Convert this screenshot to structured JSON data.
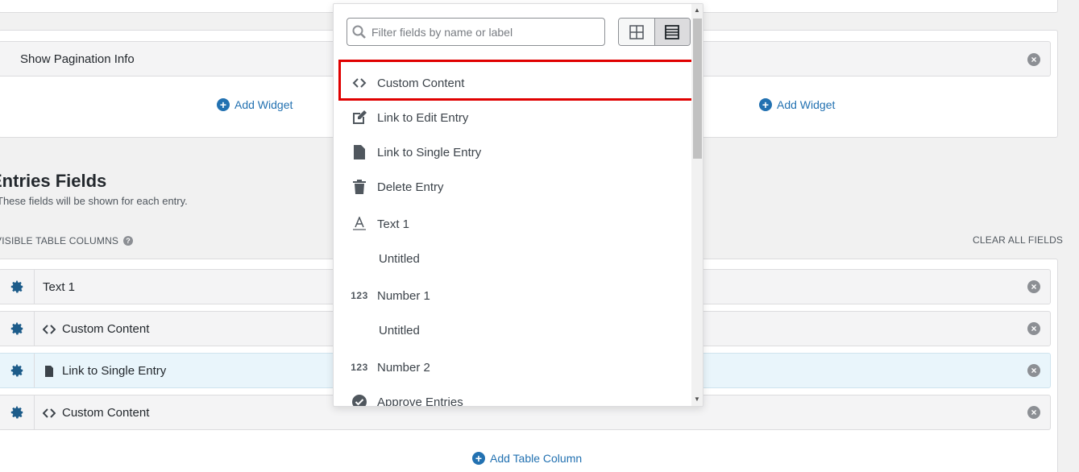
{
  "header": {
    "widget_row_label": "Show Pagination Info",
    "add_widget_left": "Add Widget",
    "add_widget_right": "Add Widget"
  },
  "section": {
    "title": "Entries Fields",
    "description": "These fields will be shown for each entry.",
    "columns_label": "VISIBLE TABLE COLUMNS",
    "clear_all": "CLEAR ALL FIELDS",
    "add_column": "Add Table Column"
  },
  "fields": [
    {
      "label": "Text 1",
      "icon": "none"
    },
    {
      "label": "Custom Content",
      "icon": "code-icon"
    },
    {
      "label": "Link to Single Entry",
      "icon": "document-icon"
    },
    {
      "label": "Custom Content",
      "icon": "code-icon"
    }
  ],
  "dropdown": {
    "search_placeholder": "Filter fields by name or label",
    "items": [
      {
        "label": "Custom Content",
        "icon": "code-icon"
      },
      {
        "label": "Link to Edit Entry",
        "icon": "edit-icon"
      },
      {
        "label": "Link to Single Entry",
        "icon": "document-icon"
      },
      {
        "label": "Delete Entry",
        "icon": "trash-icon"
      },
      {
        "label": "Text 1",
        "icon": "text-icon"
      },
      {
        "label": "Untitled",
        "icon": "none"
      },
      {
        "label": "Number 1",
        "icon": "number-icon"
      },
      {
        "label": "Untitled",
        "icon": "none"
      },
      {
        "label": "Number 2",
        "icon": "number-icon"
      },
      {
        "label": "Approve Entries",
        "icon": "check-circle-icon"
      }
    ],
    "number_icon_text": "123"
  },
  "colors": {
    "accent": "#2271b1",
    "highlight_border": "#e00000",
    "gear": "#1d5c8a"
  }
}
